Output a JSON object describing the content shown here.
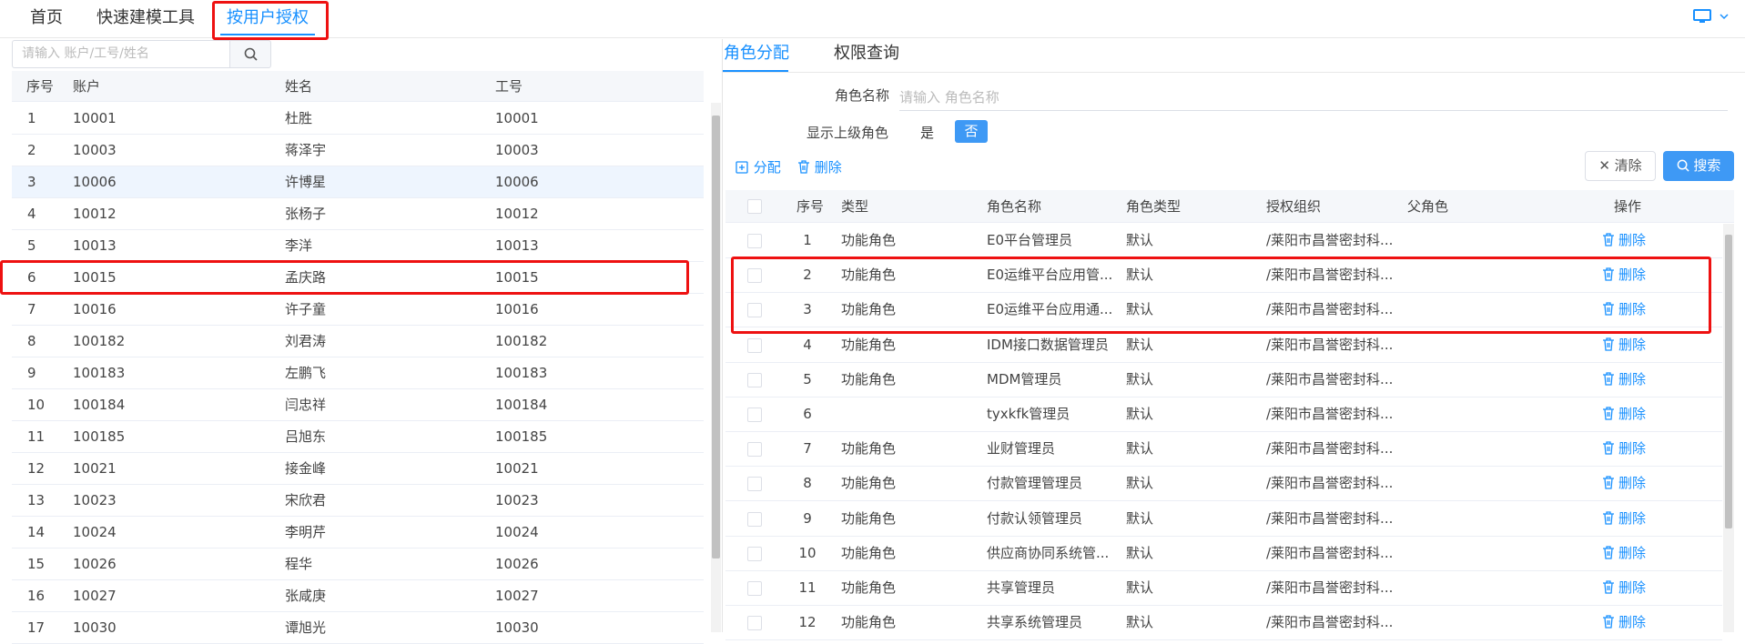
{
  "top_tabs": [
    {
      "label": "首页"
    },
    {
      "label": "快速建模工具"
    },
    {
      "label": "按用户授权"
    }
  ],
  "left": {
    "search_placeholder": "请输入 账户/工号/姓名",
    "headers": {
      "index": "序号",
      "account": "账户",
      "name": "姓名",
      "employee_id": "工号"
    },
    "rows": [
      {
        "index": "1",
        "account": "10001",
        "name": "杜胜",
        "employee_id": "10001"
      },
      {
        "index": "2",
        "account": "10003",
        "name": "蒋泽宇",
        "employee_id": "10003"
      },
      {
        "index": "3",
        "account": "10006",
        "name": "许博星",
        "employee_id": "10006"
      },
      {
        "index": "4",
        "account": "10012",
        "name": "张杨子",
        "employee_id": "10012"
      },
      {
        "index": "5",
        "account": "10013",
        "name": "李洋",
        "employee_id": "10013"
      },
      {
        "index": "6",
        "account": "10015",
        "name": "孟庆路",
        "employee_id": "10015"
      },
      {
        "index": "7",
        "account": "10016",
        "name": "许子童",
        "employee_id": "10016"
      },
      {
        "index": "8",
        "account": "100182",
        "name": "刘君涛",
        "employee_id": "100182"
      },
      {
        "index": "9",
        "account": "100183",
        "name": "左鹏飞",
        "employee_id": "100183"
      },
      {
        "index": "10",
        "account": "100184",
        "name": "闫忠祥",
        "employee_id": "100184"
      },
      {
        "index": "11",
        "account": "100185",
        "name": "吕旭东",
        "employee_id": "100185"
      },
      {
        "index": "12",
        "account": "10021",
        "name": "接金峰",
        "employee_id": "10021"
      },
      {
        "index": "13",
        "account": "10023",
        "name": "宋欣君",
        "employee_id": "10023"
      },
      {
        "index": "14",
        "account": "10024",
        "name": "李明芹",
        "employee_id": "10024"
      },
      {
        "index": "15",
        "account": "10026",
        "name": "程华",
        "employee_id": "10026"
      },
      {
        "index": "16",
        "account": "10027",
        "name": "张咸庚",
        "employee_id": "10027"
      },
      {
        "index": "17",
        "account": "10030",
        "name": "谭旭光",
        "employee_id": "10030"
      }
    ]
  },
  "right": {
    "tabs": [
      {
        "label": "角色分配"
      },
      {
        "label": "权限查询"
      }
    ],
    "role_name_label": "角色名称",
    "role_name_placeholder": "请输入 角色名称",
    "show_parent_label": "显示上级角色",
    "option_yes": "是",
    "option_no": "否",
    "assign_label": "分配",
    "delete_label": "删除",
    "clear_label": "清除",
    "search_label": "搜索",
    "headers": {
      "index": "序号",
      "type": "类型",
      "role_name": "角色名称",
      "role_type": "角色类型",
      "org": "授权组织",
      "parent": "父角色",
      "action": "操作"
    },
    "row_delete_label": "删除",
    "rows": [
      {
        "index": "1",
        "type": "功能角色",
        "role_name": "E0平台管理员",
        "role_type": "默认",
        "org": "/莱阳市昌誉密封科..."
      },
      {
        "index": "2",
        "type": "功能角色",
        "role_name": "E0运维平台应用管...",
        "role_type": "默认",
        "org": "/莱阳市昌誉密封科..."
      },
      {
        "index": "3",
        "type": "功能角色",
        "role_name": "E0运维平台应用通...",
        "role_type": "默认",
        "org": "/莱阳市昌誉密封科..."
      },
      {
        "index": "4",
        "type": "功能角色",
        "role_name": "IDM接口数据管理员",
        "role_type": "默认",
        "org": "/莱阳市昌誉密封科..."
      },
      {
        "index": "5",
        "type": "功能角色",
        "role_name": "MDM管理员",
        "role_type": "默认",
        "org": "/莱阳市昌誉密封科..."
      },
      {
        "index": "6",
        "type": "",
        "role_name": "tyxkfk管理员",
        "role_type": "默认",
        "org": "/莱阳市昌誉密封科..."
      },
      {
        "index": "7",
        "type": "功能角色",
        "role_name": "业财管理员",
        "role_type": "默认",
        "org": "/莱阳市昌誉密封科..."
      },
      {
        "index": "8",
        "type": "功能角色",
        "role_name": "付款管理管理员",
        "role_type": "默认",
        "org": "/莱阳市昌誉密封科..."
      },
      {
        "index": "9",
        "type": "功能角色",
        "role_name": "付款认领管理员",
        "role_type": "默认",
        "org": "/莱阳市昌誉密封科..."
      },
      {
        "index": "10",
        "type": "功能角色",
        "role_name": "供应商协同系统管...",
        "role_type": "默认",
        "org": "/莱阳市昌誉密封科..."
      },
      {
        "index": "11",
        "type": "功能角色",
        "role_name": "共享管理员",
        "role_type": "默认",
        "org": "/莱阳市昌誉密封科..."
      },
      {
        "index": "12",
        "type": "功能角色",
        "role_name": "共享系统管理员",
        "role_type": "默认",
        "org": "/莱阳市昌誉密封科..."
      }
    ]
  },
  "colors": {
    "accent": "#1890ff",
    "highlight": "#ee1111",
    "selected_row": "#eef5fe"
  },
  "icons": [
    "monitor-icon",
    "chevron-down-icon",
    "search-icon",
    "add-icon",
    "trash-icon",
    "close-icon"
  ]
}
